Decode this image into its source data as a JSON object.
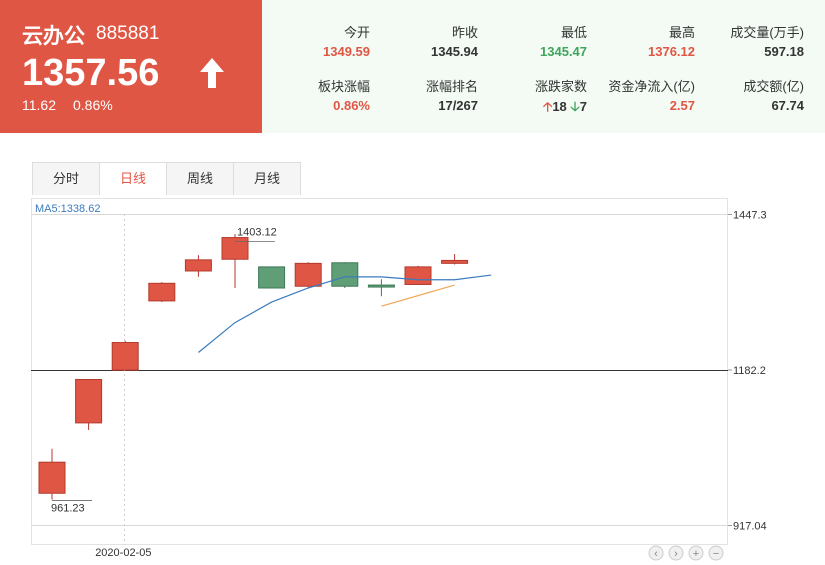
{
  "header": {
    "name": "云办公",
    "code": "885881",
    "price": "1357.56",
    "change": "11.62",
    "change_pct": "0.86%",
    "trend_icon": "arrow-up-icon",
    "accent_color": "#e05645",
    "down_color": "#3fa55c"
  },
  "stats": [
    {
      "label": "今开",
      "value": "1349.59",
      "tone": "up"
    },
    {
      "label": "昨收",
      "value": "1345.94",
      "tone": "neutral"
    },
    {
      "label": "最低",
      "value": "1345.47",
      "tone": "down"
    },
    {
      "label": "最高",
      "value": "1376.12",
      "tone": "up"
    },
    {
      "label": "成交量(万手)",
      "value": "597.18",
      "tone": "neutral"
    },
    {
      "label": "板块涨幅",
      "value": "0.86%",
      "tone": "up"
    },
    {
      "label": "涨幅排名",
      "value": "17/267",
      "tone": "neutral"
    },
    {
      "label": "涨跌家数",
      "up": "18",
      "down": "7",
      "tone": "mixed"
    },
    {
      "label": "资金净流入(亿)",
      "value": "2.57",
      "tone": "up"
    },
    {
      "label": "成交额(亿)",
      "value": "67.74",
      "tone": "neutral"
    }
  ],
  "tabs": [
    {
      "label": "分时",
      "active": false
    },
    {
      "label": "日线",
      "active": true
    },
    {
      "label": "周线",
      "active": false
    },
    {
      "label": "月线",
      "active": false
    }
  ],
  "chart_data": {
    "type": "candlestick",
    "ma_label": "MA5:1338.62",
    "y_ticks": [
      "1447.3",
      "1182.2",
      "917.04"
    ],
    "y_tick_values": [
      1447.3,
      1182.2,
      917.04
    ],
    "x_ticks": [
      {
        "label": "2020-02-05",
        "index": 2
      }
    ],
    "annotations": [
      {
        "label": "1403.12",
        "index": 5,
        "value": 1403.12,
        "kind": "high"
      },
      {
        "label": "961.23",
        "index": 0,
        "value": 961.23,
        "kind": "low"
      }
    ],
    "candles": [
      {
        "open": 972,
        "close": 1025,
        "high": 1048,
        "low": 961.23
      },
      {
        "open": 1092,
        "close": 1166,
        "high": 1166,
        "low": 1080
      },
      {
        "open": 1182,
        "close": 1229,
        "high": 1232,
        "low": 1182
      },
      {
        "open": 1300,
        "close": 1330,
        "high": 1332,
        "low": 1298
      },
      {
        "open": 1351,
        "close": 1370,
        "high": 1378,
        "low": 1341
      },
      {
        "open": 1371,
        "close": 1408,
        "high": 1414,
        "low": 1322
      },
      {
        "open": 1358,
        "close": 1322,
        "high": 1358,
        "low": 1321
      },
      {
        "open": 1325,
        "close": 1364,
        "high": 1366,
        "low": 1323
      },
      {
        "open": 1365,
        "close": 1325,
        "high": 1366,
        "low": 1322
      },
      {
        "open": 1327,
        "close": 1325,
        "high": 1337,
        "low": 1308
      },
      {
        "open": 1328,
        "close": 1358,
        "high": 1360,
        "low": 1328
      },
      {
        "open": 1364,
        "close": 1369,
        "high": 1380,
        "low": 1362
      }
    ],
    "ma5": [
      null,
      null,
      null,
      null,
      1212,
      1263,
      1298,
      1322,
      1341,
      1341,
      1336,
      1336,
      1344
    ],
    "ma10": [
      null,
      null,
      null,
      null,
      null,
      null,
      null,
      null,
      null,
      1291,
      1309,
      1327
    ],
    "ma5_color": "#3b7bbd",
    "ma10_color": "#f0a85a",
    "up_color": "#e05645",
    "down_color": "#5f9e77",
    "nav_buttons": [
      "scroll-left-icon",
      "scroll-right-icon",
      "zoom-in-icon",
      "zoom-out-icon"
    ]
  }
}
